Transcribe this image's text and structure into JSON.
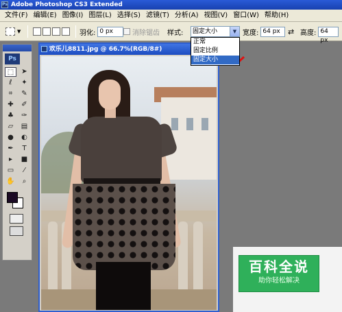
{
  "window": {
    "title": "Adobe Photoshop CS3 Extended"
  },
  "menu": {
    "items": [
      "文件(F)",
      "编辑(E)",
      "图像(I)",
      "图层(L)",
      "选择(S)",
      "滤镜(T)",
      "分析(A)",
      "视图(V)",
      "窗口(W)",
      "帮助(H)"
    ]
  },
  "options": {
    "feather_label": "羽化:",
    "feather_value": "0 px",
    "antialias_label": "消除锯齿",
    "style_label": "样式:",
    "style_value": "固定大小",
    "style_options": [
      "正常",
      "固定比例",
      "固定大小"
    ],
    "style_selected_index": 2,
    "width_label": "宽度:",
    "width_value": "64 px",
    "height_label": "高度:",
    "height_value": "64 px"
  },
  "toolbox": {
    "logo": "Ps",
    "foreground_color": "#1b0a24",
    "background_color": "#ffffff"
  },
  "document": {
    "title": "欢乐儿8811.jpg @ 66.7%(RGB/8#)"
  },
  "watermark": {
    "title": "百科全说",
    "subtitle": "助你轻松解决"
  },
  "colors": {
    "title_bar": "#1841b0",
    "menu_bg": "#ece9d8",
    "workspace": "#7a7a7a",
    "highlight": "#316ac5",
    "watermark_green": "#2fb05a"
  }
}
